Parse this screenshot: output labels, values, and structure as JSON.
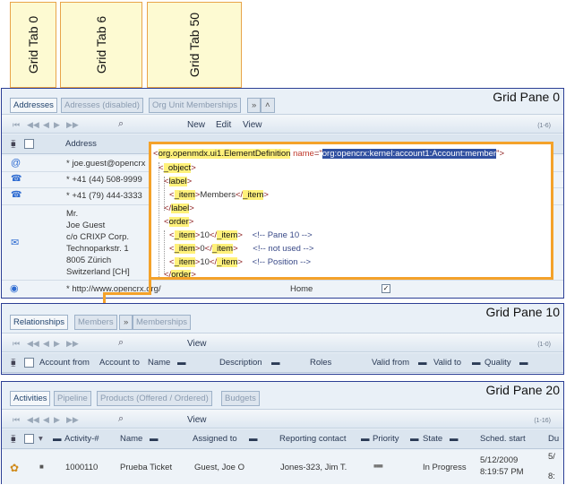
{
  "grid_tabs": [
    "Grid Tab 0",
    "Grid Tab 6",
    "Grid Tab 50"
  ],
  "pane0": {
    "title": "Grid Pane 0",
    "tabs": [
      "Addresses",
      "Adresses (disabled)",
      "Org Unit Memberships"
    ],
    "more_label": "»",
    "up_label": "˄",
    "toolbar": {
      "new": "New",
      "edit": "Edit",
      "view": "View",
      "page": "(1-6)"
    },
    "header": {
      "address": "Address"
    },
    "rows": [
      {
        "icon": "email-icon",
        "text": "* joe.guest@opencrx"
      },
      {
        "icon": "phone-icon",
        "text": "* +41 (44) 508-9999"
      },
      {
        "icon": "fax-icon",
        "text": "* +41 (79) 444-3333"
      },
      {
        "icon": "postal-icon",
        "lines": [
          "Mr.",
          "Joe Guest",
          "c/o CRIXP Corp.",
          "Technoparkstr. 1",
          "8005 Zürich",
          "Switzerland [CH]"
        ]
      },
      {
        "icon": "web-icon",
        "text": "* http://www.opencrx.org/",
        "usage": "Home"
      }
    ]
  },
  "xml": {
    "line1_tag": "org.openmdx.ui1.ElementDefinition",
    "line1_attr": "name",
    "line1_value": "org:opencrx:kernel:account1:Account:member",
    "object": "_object",
    "label": "label",
    "item": "_item",
    "members": "Members",
    "order": "order",
    "order_items": [
      {
        "value": "10",
        "comment": "<!-- Pane 10  -->"
      },
      {
        "value": "0",
        "comment": "<!-- not used  -->"
      },
      {
        "value": "10",
        "comment": "<!-- Position  -->"
      }
    ]
  },
  "pane10": {
    "title": "Grid Pane 10",
    "tabs": [
      "Relationships",
      "Members",
      "Memberships"
    ],
    "more_label": "»",
    "toolbar": {
      "view": "View",
      "page": "(1-0)"
    },
    "columns": [
      "Account from",
      "Account to",
      "Name",
      "Description",
      "Roles",
      "Valid from",
      "Valid to",
      "Quality"
    ]
  },
  "pane20": {
    "title": "Grid Pane 20",
    "tabs": [
      "Activities",
      "Pipeline",
      "Products (Offered / Ordered)",
      "Budgets"
    ],
    "toolbar": {
      "view": "View",
      "page": "(1-16)"
    },
    "columns": [
      "Activity-#",
      "Name",
      "Assigned to",
      "Reporting contact",
      "Priority",
      "State",
      "Sched. start",
      "Du"
    ],
    "row": {
      "number": "1000110",
      "name": "Prueba Ticket",
      "assigned": "Guest, Joe O",
      "reporting": "Jones-323, Jim T.",
      "state": "In Progress",
      "start_date": "5/12/2009",
      "start_time": "8:19:57 PM",
      "due_date": "5/",
      "due_time": "8:"
    }
  }
}
